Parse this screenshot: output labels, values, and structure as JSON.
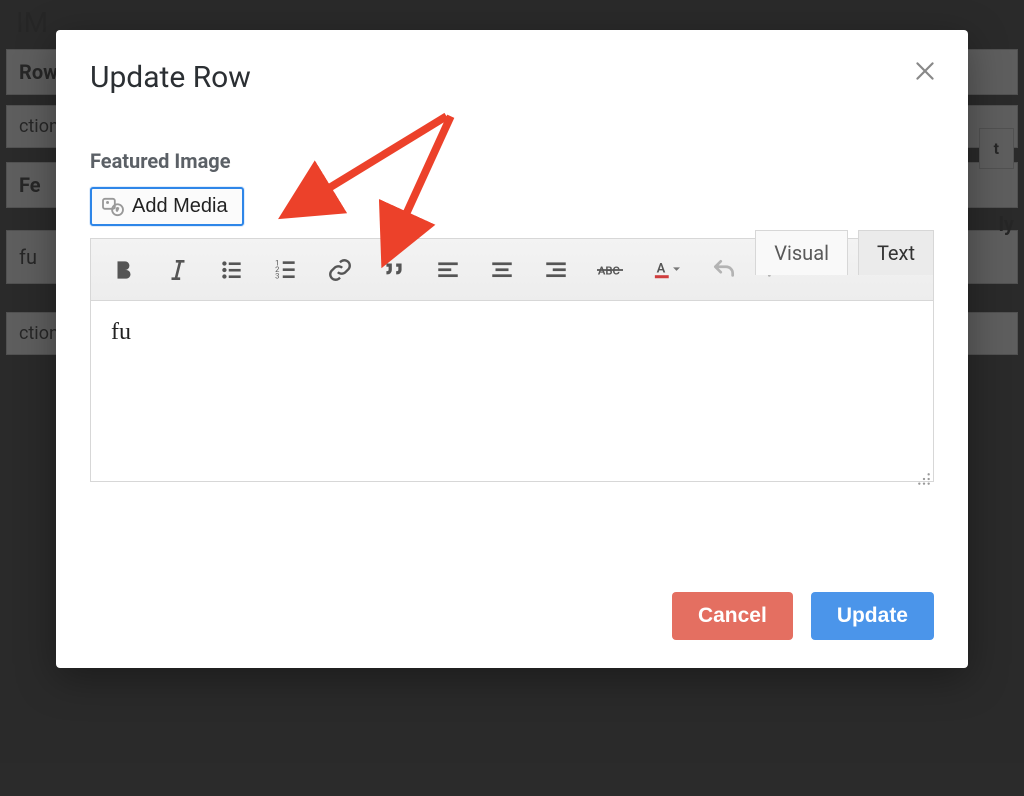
{
  "background": {
    "title_fragment": "IM",
    "row_label": "Row",
    "actions1": "ctions",
    "fe_label": "Fe",
    "fu_label": "fu",
    "actions2": "ctions",
    "right_btn": "t",
    "right_ly": "ly"
  },
  "modal": {
    "title": "Update Row",
    "field_label": "Featured Image",
    "add_media_label": "Add Media",
    "tabs": {
      "visual": "Visual",
      "text": "Text"
    },
    "editor_content": "fu",
    "footer": {
      "cancel": "Cancel",
      "update": "Update"
    }
  },
  "annotation": {
    "arrow_color": "#ec412a"
  }
}
